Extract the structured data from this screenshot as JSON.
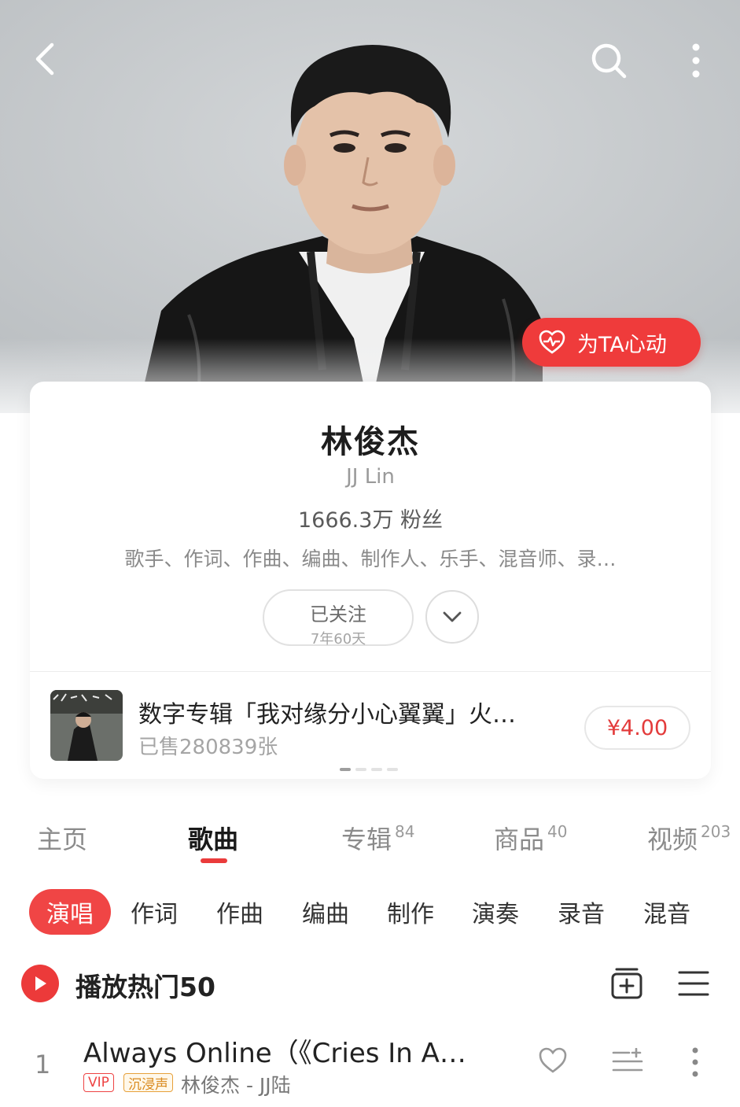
{
  "header": {
    "back_icon": "chevron-left-icon",
    "search_icon": "search-icon",
    "more_icon": "more-vertical-icon",
    "heart_button_label": "为TA心动"
  },
  "artist": {
    "name": "林俊杰",
    "alias": "JJ Lin",
    "fans": "1666.3万 粉丝",
    "roles": "歌手、作词、作曲、编曲、制作人、乐手、混音师、录…",
    "follow_label": "已关注",
    "follow_duration": "7年60天"
  },
  "promo": {
    "album_title": "数字专辑「我对缘分小心翼翼」火…",
    "sold": "已售280839张",
    "price": "¥4.00",
    "carousel_count": 4,
    "carousel_active_index": 0
  },
  "tabs": [
    {
      "label": "主页",
      "count": ""
    },
    {
      "label": "歌曲",
      "count": ""
    },
    {
      "label": "专辑",
      "count": "84"
    },
    {
      "label": "商品",
      "count": "40"
    },
    {
      "label": "视频",
      "count": "203"
    }
  ],
  "chips": [
    "演唱",
    "作词",
    "作曲",
    "编曲",
    "制作",
    "演奏",
    "录音",
    "混音"
  ],
  "play_all": {
    "label": "播放热门50"
  },
  "songs": [
    {
      "rank": "1",
      "title": "Always Online（《Cries In A…",
      "badges": [
        "VIP",
        "沉浸声"
      ],
      "artist": "林俊杰 - JJ陆"
    }
  ],
  "colors": {
    "accent": "#ec3a3a",
    "vip": "#e44444",
    "immersive": "#d98a1e"
  }
}
